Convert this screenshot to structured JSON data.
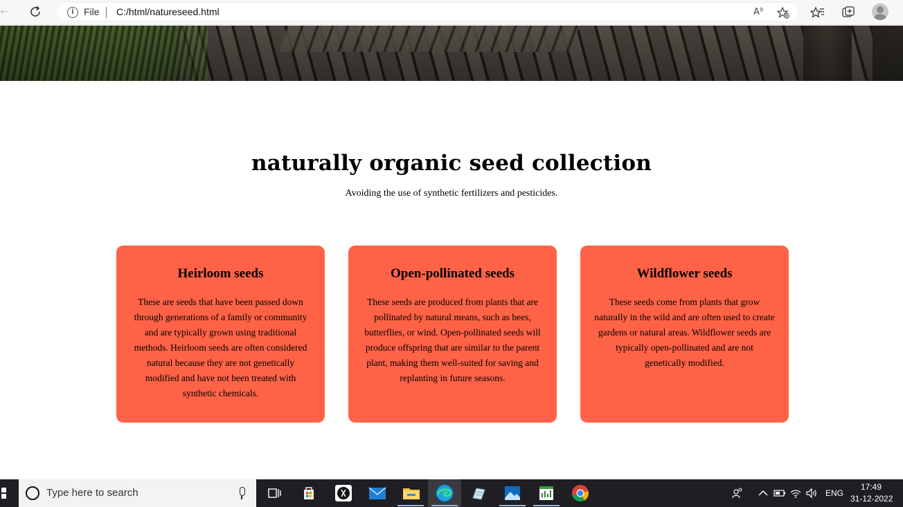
{
  "browser": {
    "file_label": "File",
    "url": "C:/html/natureseed.html",
    "read_aloud_icon_label": "A⁹"
  },
  "hero": {
    "image": "boardwalk-grass-photo"
  },
  "main": {
    "title": "naturally organic seed collection",
    "subtitle": "Avoiding the use of synthetic fertilizers and pesticides."
  },
  "cards": [
    {
      "title": "Heirloom seeds",
      "text": "These are seeds that have been passed down through generations of a family or community and are typically grown using traditional methods. Heirloom seeds are often considered natural because they are not genetically modified and have not been treated with synthetic chemicals."
    },
    {
      "title": "Open-pollinated seeds",
      "text": "These seeds are produced from plants that are pollinated by natural means, such as bees, butterflies, or wind. Open-pollinated seeds will produce offspring that are similar to the parent plant, making them well-suited for saving and replanting in future seasons."
    },
    {
      "title": "Wildflower seeds",
      "text": "These seeds come from plants that grow naturally in the wild and are often used to create gardens or natural areas. Wildflower seeds are typically open-pollinated and are not genetically modified."
    }
  ],
  "taskbar": {
    "search_placeholder": "Type here to search",
    "language": "ENG",
    "time": "17:49",
    "date": "31-12-2022",
    "pinned_apps": [
      "task-view",
      "microsoft-store",
      "media-app",
      "mail",
      "file-explorer",
      "edge",
      "notes-app",
      "photos",
      "excel-like-app",
      "chrome"
    ]
  },
  "colors": {
    "card_background": "#ff6347",
    "taskbar": "#1f1f23",
    "browser_bar": "#f7f7f7"
  }
}
